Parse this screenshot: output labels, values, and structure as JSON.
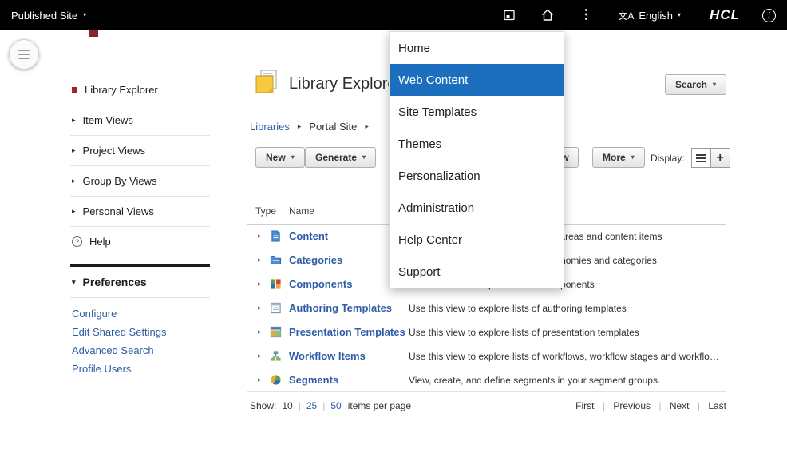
{
  "icons": {
    "caret_down": "▾",
    "arrow_right": "▸",
    "kebab": "⋮",
    "info": "i",
    "translate": "文A",
    "help": "?",
    "plus": "+"
  },
  "topbar": {
    "site_selector": "Published Site",
    "language": "English",
    "brand": "HCL"
  },
  "menu": {
    "items": [
      {
        "label": "Home"
      },
      {
        "label": "Web Content",
        "selected": true
      },
      {
        "label": "Site Templates"
      },
      {
        "label": "Themes"
      },
      {
        "label": "Personalization"
      },
      {
        "label": "Administration"
      },
      {
        "label": "Help Center"
      },
      {
        "label": "Support"
      }
    ],
    "selected_color": "#1b6fbe"
  },
  "sidebar": {
    "items": [
      {
        "label": "Library Explorer",
        "selected": true
      },
      {
        "label": "Item Views"
      },
      {
        "label": "Project Views"
      },
      {
        "label": "Group By Views"
      },
      {
        "label": "Personal Views"
      }
    ],
    "help": "Help",
    "preferences": "Preferences",
    "links": [
      "Configure",
      "Edit Shared Settings",
      "Advanced Search",
      "Profile Users"
    ]
  },
  "main": {
    "title": "Library Explorer",
    "breadcrumb": [
      "Libraries",
      "Portal Site"
    ],
    "search_button": "Search",
    "toolbar": {
      "buttons": [
        "New",
        "Generate",
        "Preview",
        "More"
      ],
      "display_label": "Display:"
    },
    "table": {
      "headers": {
        "type": "Type",
        "name": "Name"
      },
      "rows": [
        {
          "icon": "content-icon",
          "name": "Content",
          "description": "Use this view to explore lists of site areas and content items"
        },
        {
          "icon": "categories-icon",
          "name": "Categories",
          "description": "Use this view to explore lists of taxonomies and categories"
        },
        {
          "icon": "components-icon",
          "name": "Components",
          "description": "Use this view to explore lists of components"
        },
        {
          "icon": "authoring-templates-icon",
          "name": "Authoring Templates",
          "description": "Use this view to explore lists of authoring templates"
        },
        {
          "icon": "presentation-templates-icon",
          "name": "Presentation Templates",
          "description": "Use this view to explore lists of presentation templates"
        },
        {
          "icon": "workflow-items-icon",
          "name": "Workflow Items",
          "description": "Use this view to explore lists of workflows, workflow stages and workflow actio…"
        },
        {
          "icon": "segments-icon",
          "name": "Segments",
          "description": "View, create, and define segments in your segment groups."
        }
      ]
    },
    "pagination": {
      "show_label": "Show:",
      "sizes": [
        "10",
        "25",
        "50"
      ],
      "suffix": "items per page",
      "nav": [
        "First",
        "Previous",
        "Next",
        "Last"
      ]
    }
  }
}
